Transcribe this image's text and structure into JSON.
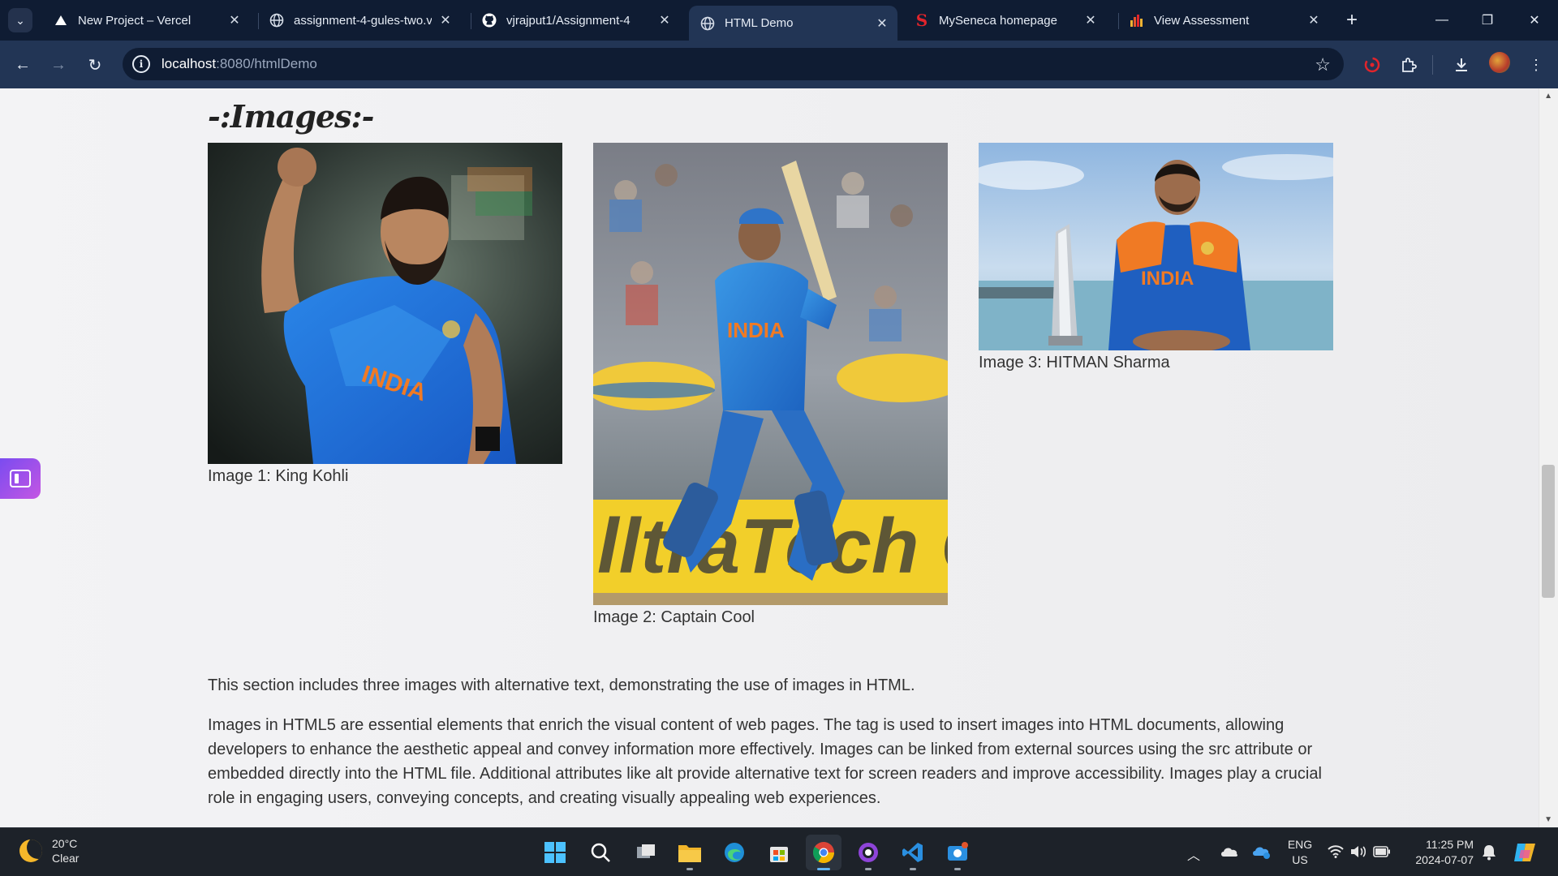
{
  "browser": {
    "tabs": [
      {
        "title": "New Project – Vercel",
        "favicon": "vercel-icon",
        "active": false
      },
      {
        "title": "assignment-4-gules-two.ve",
        "favicon": "globe-icon",
        "active": false
      },
      {
        "title": "vjrajput1/Assignment-4",
        "favicon": "github-icon",
        "active": false
      },
      {
        "title": "HTML Demo",
        "favicon": "globe-icon",
        "active": true
      },
      {
        "title": "MySeneca homepage",
        "favicon": "seneca-icon",
        "active": false
      },
      {
        "title": "View Assessment",
        "favicon": "chart-bars-icon",
        "active": false
      }
    ],
    "address": {
      "host": "localhost",
      "path": ":8080/htmlDemo"
    }
  },
  "page": {
    "heading": "-:Images:-",
    "figures": [
      {
        "caption": "Image 1: King Kohli",
        "alt": "King Kohli"
      },
      {
        "caption": "Image 2: Captain Cool",
        "alt": "Captain Cool"
      },
      {
        "caption": "Image 3: HITMAN Sharma",
        "alt": "HITMAN Sharma"
      }
    ],
    "jersey_text": "INDIA",
    "paragraph1": "This section includes three images with alternative text, demonstrating the use of images in HTML.",
    "paragraph2": "Images in HTML5 are essential elements that enrich the visual content of web pages. The  tag is used to insert images into HTML documents, allowing developers to enhance the aesthetic appeal and convey information more effectively. Images can be linked from external sources using the src attribute or embedded directly into the HTML file. Additional attributes like alt provide alternative text for screen readers and improve accessibility. Images play a crucial role in engaging users, conveying concepts, and creating visually appealing web experiences."
  },
  "taskbar": {
    "weather": {
      "temp": "20°C",
      "condition": "Clear"
    },
    "language": {
      "line1": "ENG",
      "line2": "US"
    },
    "clock": {
      "time": "11:25 PM",
      "date": "2024-07-07"
    }
  },
  "colors": {
    "tab_strip": "#0f1c33",
    "toolbar": "#223555",
    "page_bg": "#f3f3f5",
    "taskbar": "#1d2229",
    "india_blue": "#1f6fd8",
    "india_orange": "#f07a24"
  }
}
